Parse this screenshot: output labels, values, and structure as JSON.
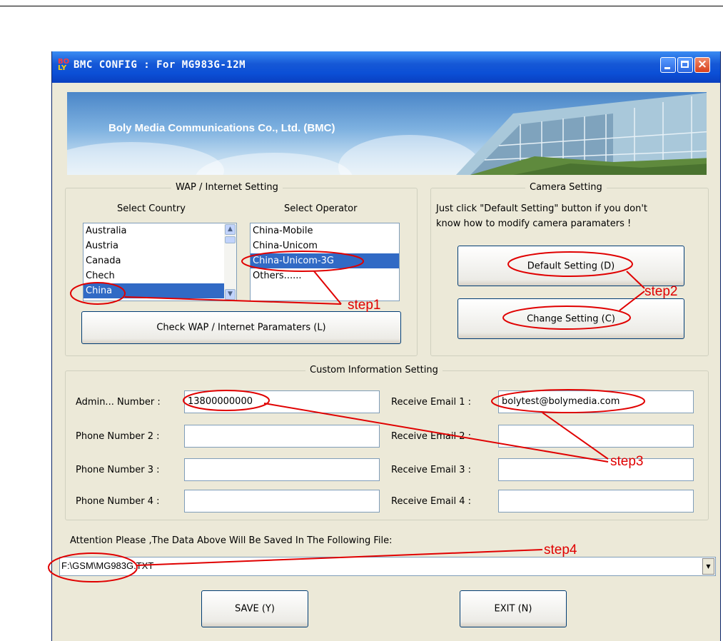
{
  "window": {
    "title": "BMC CONFIG : For MG983G-12M",
    "icon": "app-icon",
    "buttons": [
      "minimize",
      "maximize",
      "close"
    ]
  },
  "banner": {
    "text": "Boly Media Communications Co., Ltd. (BMC)"
  },
  "wap": {
    "group_title": "WAP / Internet Setting",
    "country_label": "Select Country",
    "operator_label": "Select Operator",
    "countries": [
      "Australia",
      "Austria",
      "Canada",
      "Chech",
      "China"
    ],
    "selected_country": "China",
    "operators": [
      "China-Mobile",
      "China-Unicom",
      "China-Unicom-3G",
      "Others......"
    ],
    "selected_operator": "China-Unicom-3G",
    "check_button": "Check WAP / Internet Paramaters (L)"
  },
  "camera": {
    "group_title": "Camera Setting",
    "hint": "Just  click \"Default Setting\" button if you don't know how to modify camera paramaters !",
    "hint_line1": "Just  click \"Default Setting\" button if you don't",
    "hint_line2": "know how to modify camera paramaters !",
    "default_button": "Default Setting (D)",
    "change_button": "Change Setting (C)"
  },
  "custom": {
    "group_title": "Custom Information Setting",
    "phone_labels": [
      "Admin... Number :",
      "Phone Number 2 :",
      "Phone Number 3 :",
      "Phone Number 4 :"
    ],
    "phone_values": [
      "13800000000",
      "",
      "",
      ""
    ],
    "email_labels": [
      "Receive Email 1 :",
      "Receive Email 2 :",
      "Receive Email 3 :",
      "Receive Email 4 :"
    ],
    "email_values": [
      "bolytest@bolymedia.com",
      "",
      "",
      ""
    ]
  },
  "file": {
    "attention": "Attention Please ,The Data Above Will Be Saved In The Following  File:",
    "path": "F:\\GSM\\MG983G.TXT"
  },
  "actions": {
    "save": "SAVE (Y)",
    "exit": "EXIT (N)"
  },
  "annotations": {
    "step1": "step1",
    "step2": "step2",
    "step3": "step3",
    "step4": "step4",
    "color": "#e00000"
  }
}
